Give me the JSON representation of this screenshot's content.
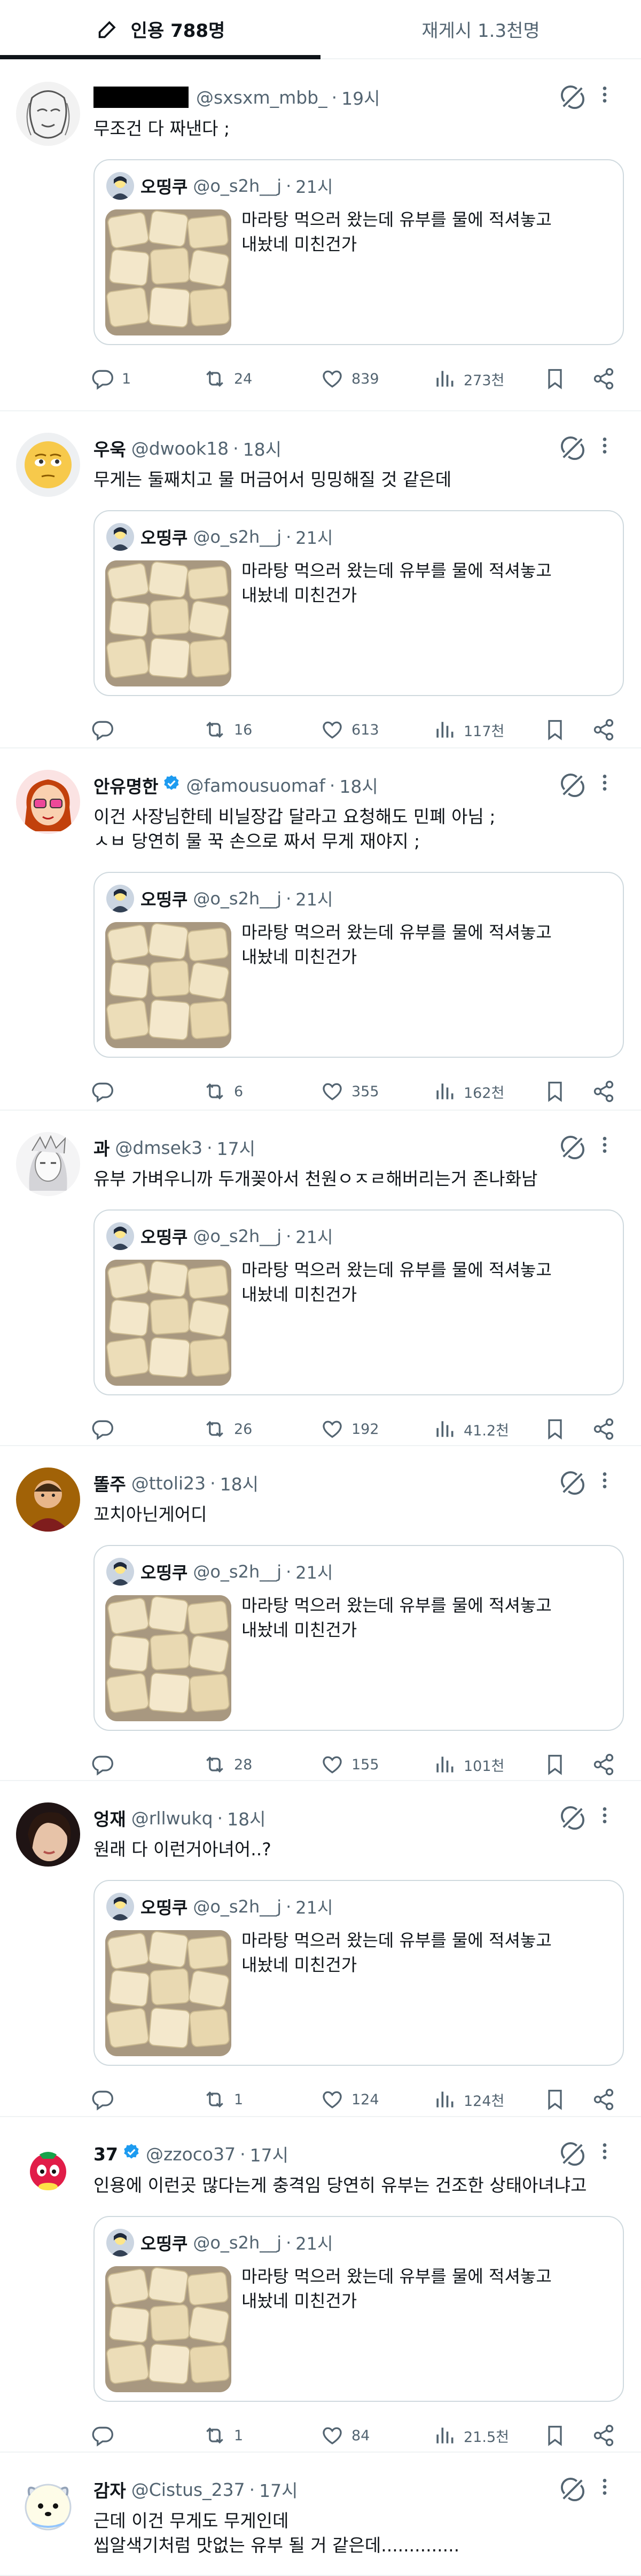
{
  "tabs": [
    {
      "label": "인용 788명",
      "icon": "pen-icon"
    },
    {
      "label": "재게시 1.3천명"
    }
  ],
  "quoted": {
    "name": "오띵쿠",
    "handle": "@o_s2h__j",
    "time": "21시",
    "text": "마라탕 먹으러 왔는데 유부를 물에 적셔놓고\n내놨네 미친건가"
  },
  "posts": [
    {
      "name": "",
      "handle": "@sxsxm_mbb_",
      "time": "19시",
      "text": "무조건 다 짜낸다 ;",
      "replies": "1",
      "reposts": "24",
      "likes": "839",
      "views": "273천"
    },
    {
      "name": "우욱",
      "handle": "@dwook18",
      "time": "18시",
      "text": "무게는 둘째치고 물 머금어서 밍밍해질 것 같은데",
      "replies": "",
      "reposts": "16",
      "likes": "613",
      "views": "117천"
    },
    {
      "name": "안유명한",
      "handle": "@famousuomaf",
      "time": "18시",
      "text": "이건 사장님한테 비닐장갑 달라고 요청해도 민폐 아님 ;\nㅅㅂ 당연히 물 꾹 손으로 짜서 무게 재야지 ;",
      "replies": "",
      "reposts": "6",
      "likes": "355",
      "views": "162천"
    },
    {
      "name": "과",
      "handle": "@dmsek3",
      "time": "17시",
      "text": "유부 가벼우니까 두개꽂아서 천원ㅇㅈㄹ해버리는거 존나화남",
      "replies": "",
      "reposts": "26",
      "likes": "192",
      "views": "41.2천"
    },
    {
      "name": "똘주",
      "handle": "@ttoli23",
      "time": "18시",
      "text": "꼬치아닌게어디",
      "replies": "",
      "reposts": "28",
      "likes": "155",
      "views": "101천"
    },
    {
      "name": "엉재",
      "handle": "@rllwukq",
      "time": "18시",
      "text": "원래 다 이런거아녀어..?",
      "replies": "",
      "reposts": "1",
      "likes": "124",
      "views": "124천"
    },
    {
      "name": "37",
      "handle": "@zzoco37",
      "time": "17시",
      "text": "인용에 이런곳 많다는게 충격임 당연히 유부는 건조한 상태아녀냐고",
      "replies": "",
      "reposts": "1",
      "likes": "84",
      "views": "21.5천"
    },
    {
      "name": "감자",
      "handle": "@Cistus_237",
      "time": "17시",
      "text": "근데 이건 무게도 무게인데\n씹알색기처럼 맛없는 유부 될 거 같은데..............",
      "replies": "",
      "reposts": "",
      "likes": "",
      "views": ""
    }
  ],
  "colors": {
    "text": "#0f1419",
    "muted": "#536471",
    "border": "#cfd9de",
    "verified": "#1d9bf0",
    "divider": "#eff3f4"
  }
}
